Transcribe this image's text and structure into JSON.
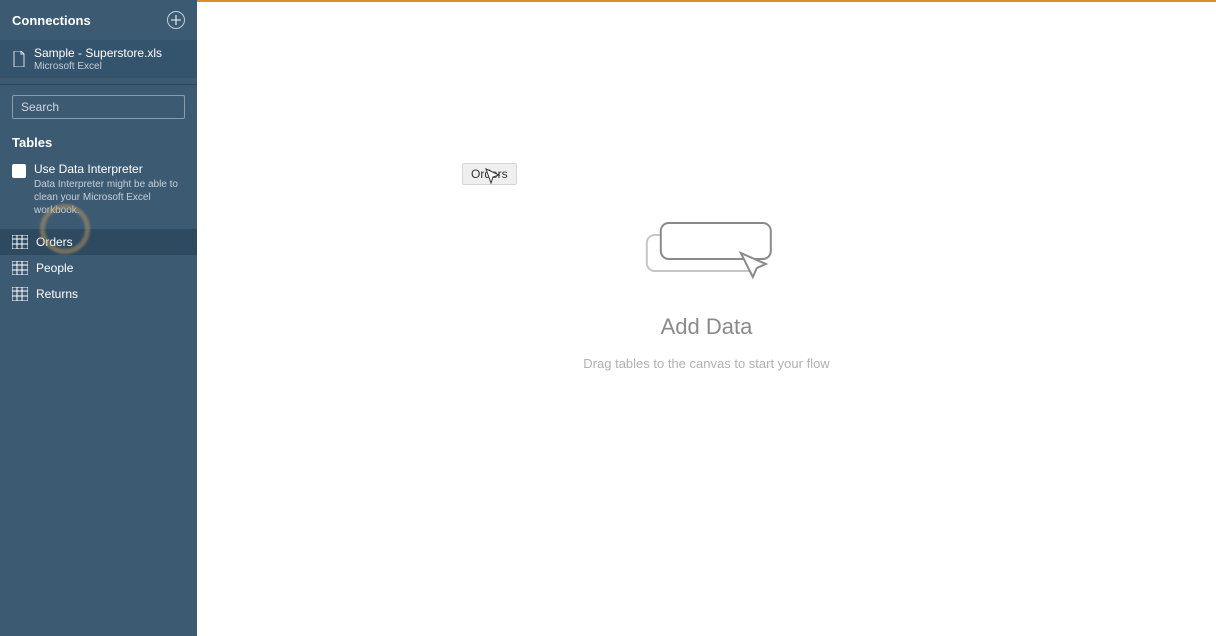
{
  "sidebar": {
    "connections_label": "Connections",
    "connection": {
      "name": "Sample - Superstore.xls",
      "type": "Microsoft Excel"
    },
    "search_placeholder": "Search",
    "tables_label": "Tables",
    "data_interpreter": {
      "label": "Use Data Interpreter",
      "hint": "Data Interpreter might be able to clean your Microsoft Excel workbook."
    },
    "tables": [
      {
        "name": "Orders",
        "active": true
      },
      {
        "name": "People",
        "active": false
      },
      {
        "name": "Returns",
        "active": false
      }
    ]
  },
  "canvas": {
    "drag_token": "Orders",
    "headline": "Add Data",
    "sub": "Drag tables to the canvas to start your flow"
  }
}
